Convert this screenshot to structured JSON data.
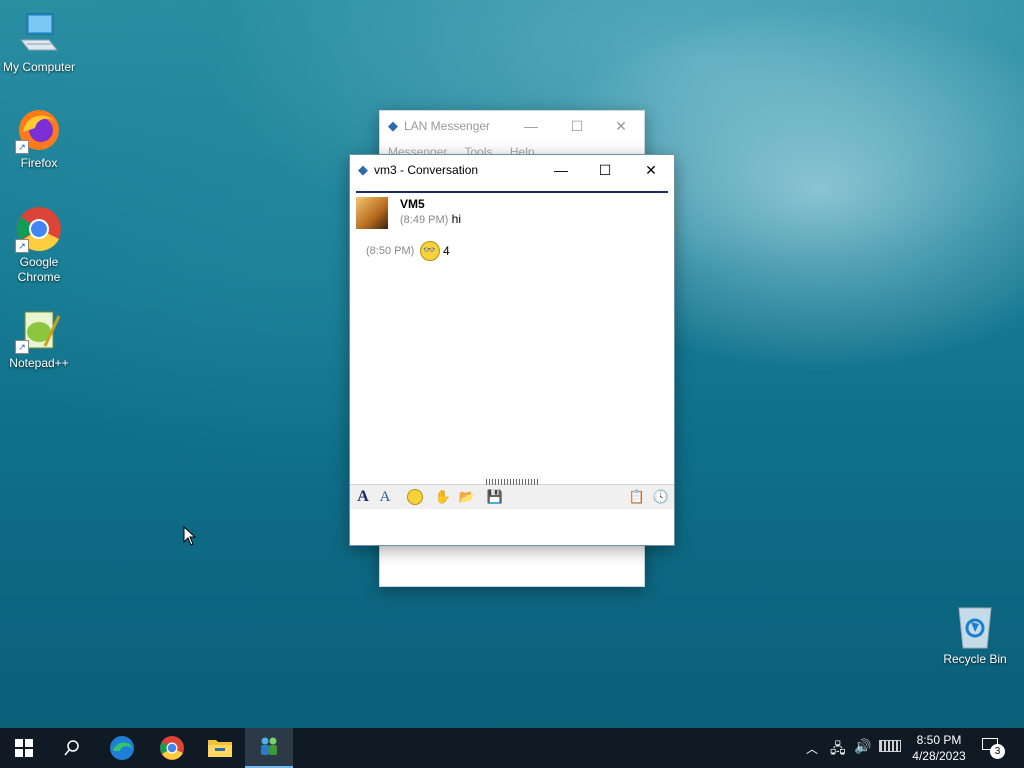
{
  "desktop": {
    "icons": [
      {
        "label": "My Computer"
      },
      {
        "label": "Firefox"
      },
      {
        "label": "Google Chrome"
      },
      {
        "label": "Notepad++"
      },
      {
        "label": "Recycle Bin"
      }
    ]
  },
  "lan_window": {
    "title": "LAN Messenger",
    "menu": [
      "Messenger",
      "Tools",
      "Help"
    ]
  },
  "conversation": {
    "title": "vm3 - Conversation",
    "messages": [
      {
        "sender": "VM5",
        "time": "(8:49 PM)",
        "text": "hi"
      },
      {
        "time": "(8:50 PM)",
        "text": "4"
      }
    ]
  },
  "taskbar": {
    "time": "8:50 PM",
    "date": "4/28/2023",
    "notification_count": "3"
  },
  "colors": {
    "taskbar_bg": "#0f1a24",
    "active_task_bg": "#2c3a47",
    "history_rule": "#1a2a6c"
  }
}
